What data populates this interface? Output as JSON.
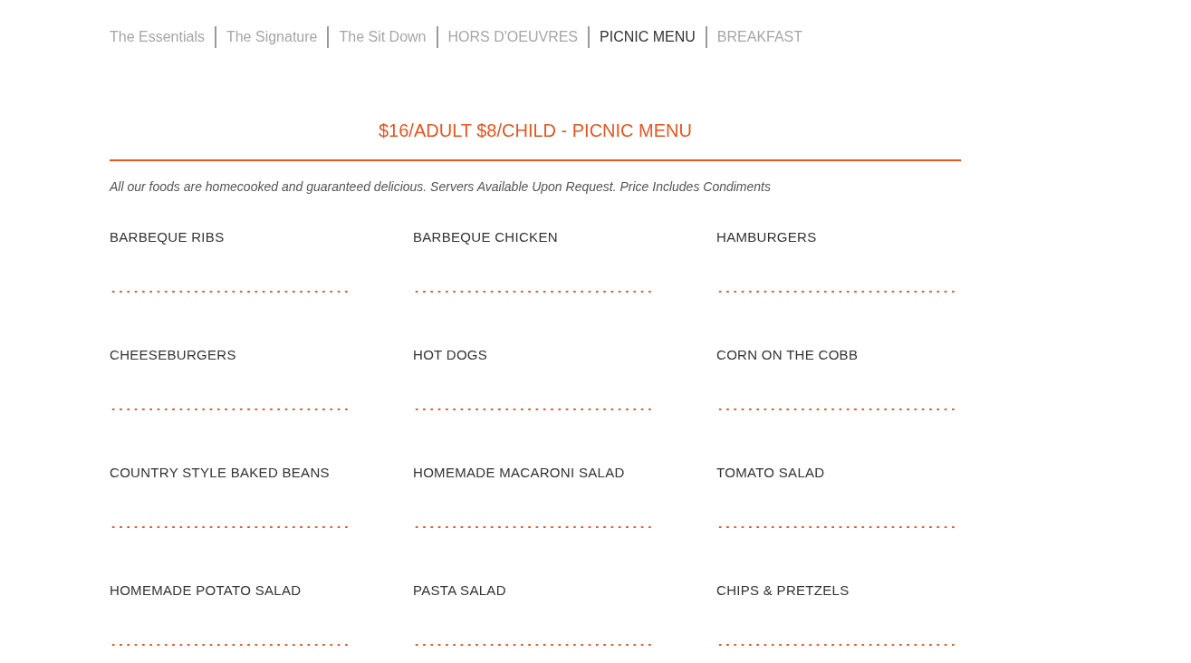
{
  "tabs": [
    {
      "label": "The Essentials",
      "selected": false
    },
    {
      "label": "The Signature",
      "selected": false
    },
    {
      "label": "The Sit Down",
      "selected": false
    },
    {
      "label": "HORS D'OEUVRES",
      "selected": false
    },
    {
      "label": "PICNIC MENU",
      "selected": true
    },
    {
      "label": "BREAKFAST",
      "selected": false
    }
  ],
  "menu": {
    "title": "$16/ADULT $8/CHILD - PICNIC MENU",
    "description": "All our foods are homecooked and guaranteed delicious. Servers Available Upon Request. Price Includes Condiments",
    "items": [
      {
        "name": "BARBEQUE RIBS"
      },
      {
        "name": "BARBEQUE CHICKEN"
      },
      {
        "name": "HAMBURGERS"
      },
      {
        "name": "CHEESEBURGERS"
      },
      {
        "name": "HOT DOGS"
      },
      {
        "name": "CORN ON THE COBB"
      },
      {
        "name": "COUNTRY STYLE BAKED BEANS"
      },
      {
        "name": "HOMEMADE MACARONI SALAD"
      },
      {
        "name": "TOMATO SALAD"
      },
      {
        "name": "HOMEMADE POTATO SALAD"
      },
      {
        "name": "PASTA SALAD"
      },
      {
        "name": "CHIPS & PRETZELS"
      }
    ]
  }
}
